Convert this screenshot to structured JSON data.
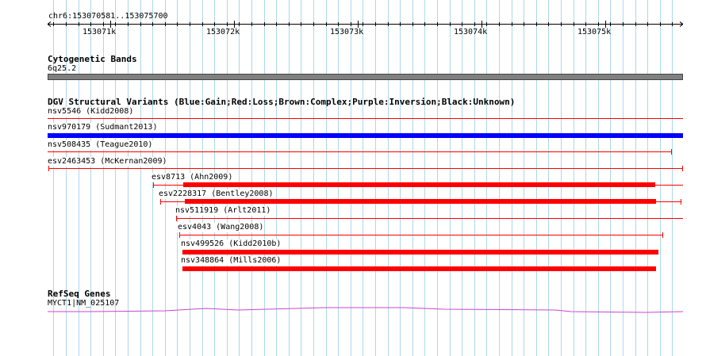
{
  "ruler": {
    "region": "chr6:153070581..153075700",
    "ticks": [
      {
        "label": "153071k"
      },
      {
        "label": "153072k"
      },
      {
        "label": "153073k"
      },
      {
        "label": "153074k"
      },
      {
        "label": "153075k"
      }
    ]
  },
  "cytobands": {
    "title": "Cytogenetic Bands",
    "band": "6q25.2",
    "color": "#808080"
  },
  "dgv": {
    "title": "DGV Structural Variants (Blue:Gain;Red:Loss;Brown:Complex;Purple:Inversion;Black:Unknown)",
    "colors": {
      "gain": "#0000ff",
      "loss": "#ff0000"
    },
    "variants": [
      {
        "label": "nsv5546 (Kidd2008)",
        "type": "loss"
      },
      {
        "label": "nsv970179 (Sudmant2013)",
        "type": "gain"
      },
      {
        "label": "nsv508435 (Teague2010)",
        "type": "loss"
      },
      {
        "label": "esv2463453 (McKernan2009)",
        "type": "loss"
      },
      {
        "label": "esv8713 (Ahn2009)",
        "type": "loss"
      },
      {
        "label": "esv2228317 (Bentley2008)",
        "type": "loss"
      },
      {
        "label": "nsv511919 (Arlt2011)",
        "type": "loss"
      },
      {
        "label": "esv4043 (Wang2008)",
        "type": "loss"
      },
      {
        "label": "nsv499526 (Kidd2010b)",
        "type": "loss"
      },
      {
        "label": "nsv348864 (Mills2006)",
        "type": "loss"
      }
    ]
  },
  "refseq": {
    "title": "RefSeq Genes",
    "gene": "MYCT1|NM_025107",
    "color": "#cc44cc"
  },
  "grid_color": "#add8e6"
}
